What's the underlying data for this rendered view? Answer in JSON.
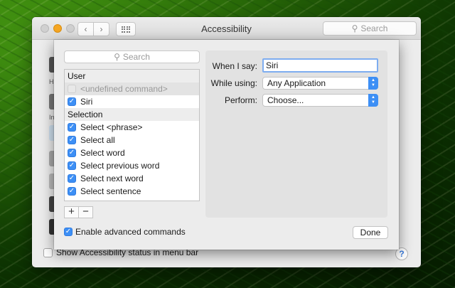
{
  "window": {
    "title": "Accessibility",
    "search_placeholder": "Search",
    "back_icon": "chevron-left-icon",
    "forward_icon": "chevron-right-icon",
    "show_all_icon": "grid-icon",
    "sidebar_fragments": [
      "H",
      "In"
    ],
    "status_menu_label": "Show Accessibility status in menu bar",
    "help_label": "?"
  },
  "sheet": {
    "search_placeholder": "Search",
    "sections": [
      {
        "title": "User",
        "items": [
          {
            "label": "<undefined command>",
            "checked": false,
            "disabled": true
          },
          {
            "label": "Siri",
            "checked": true
          }
        ]
      },
      {
        "title": "Selection",
        "items": [
          {
            "label": "Select <phrase>",
            "checked": true
          },
          {
            "label": "Select all",
            "checked": true
          },
          {
            "label": "Select word",
            "checked": true
          },
          {
            "label": "Select previous word",
            "checked": true
          },
          {
            "label": "Select next word",
            "checked": true
          },
          {
            "label": "Select sentence",
            "checked": true
          }
        ]
      }
    ],
    "add_label": "+",
    "remove_label": "−",
    "enable_advanced_label": "Enable advanced commands",
    "enable_advanced_checked": true,
    "form": {
      "when_label": "When I say:",
      "when_value": "Siri",
      "while_label": "While using:",
      "while_value": "Any Application",
      "perform_label": "Perform:",
      "perform_value": "Choose..."
    },
    "done_label": "Done"
  },
  "colors": {
    "accent": "#3d8ff5",
    "focus_ring": "#7eadf0"
  }
}
